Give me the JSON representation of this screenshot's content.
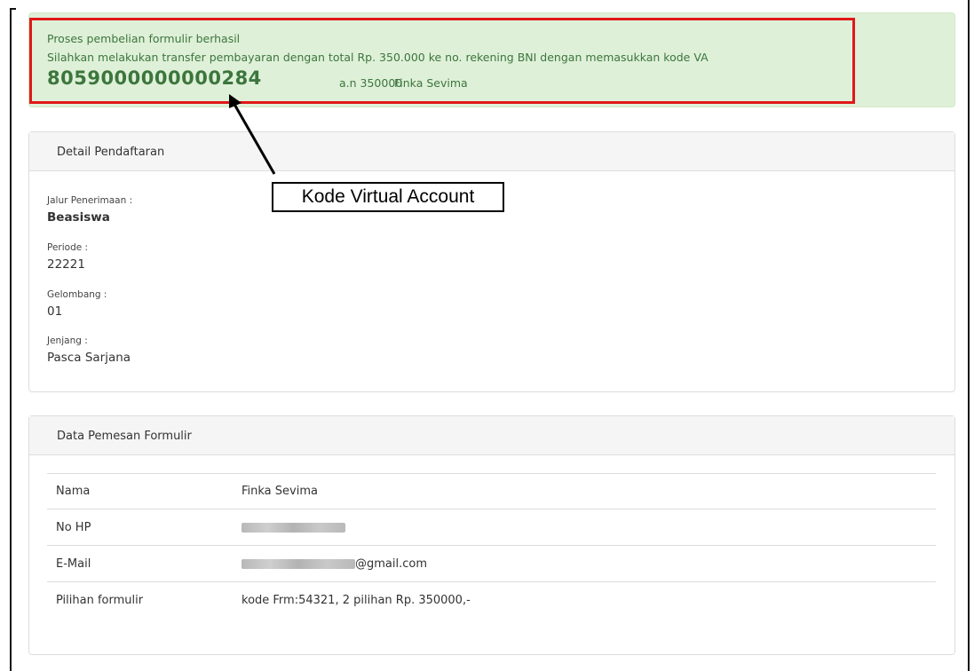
{
  "alert": {
    "line1": "Proses pembelian formulir berhasil",
    "line2": "Silahkan melakukan transfer pembayaran dengan total Rp. 350.000 ke no. rekening BNI dengan memasukkan kode VA",
    "va_code": "8059000000000284",
    "va_suffix": "a.n 350000",
    "va_name": "Finka Sevima",
    "highlight_color": "#e01818",
    "background_color": "#dff0d8",
    "text_color": "#3c763d"
  },
  "annotation": {
    "callout_label": "Kode Virtual Account"
  },
  "detail_pendaftaran": {
    "title": "Detail Pendaftaran",
    "fields": [
      {
        "label": "Jalur Penerimaan :",
        "value": "Beasiswa"
      },
      {
        "label": "Periode :",
        "value": "22221"
      },
      {
        "label": "Gelombang :",
        "value": "01"
      },
      {
        "label": "Jenjang :",
        "value": "Pasca Sarjana"
      }
    ]
  },
  "data_pemesan": {
    "title": "Data Pemesan Formulir",
    "rows": [
      {
        "key": "Nama",
        "value": "Finka Sevima"
      },
      {
        "key": "No HP",
        "value": ""
      },
      {
        "key": "E-Mail",
        "value": "@gmail.com"
      },
      {
        "key": "Pilihan formulir",
        "value": "kode Frm:54321, 2 pilihan Rp. 350000,-"
      }
    ]
  }
}
